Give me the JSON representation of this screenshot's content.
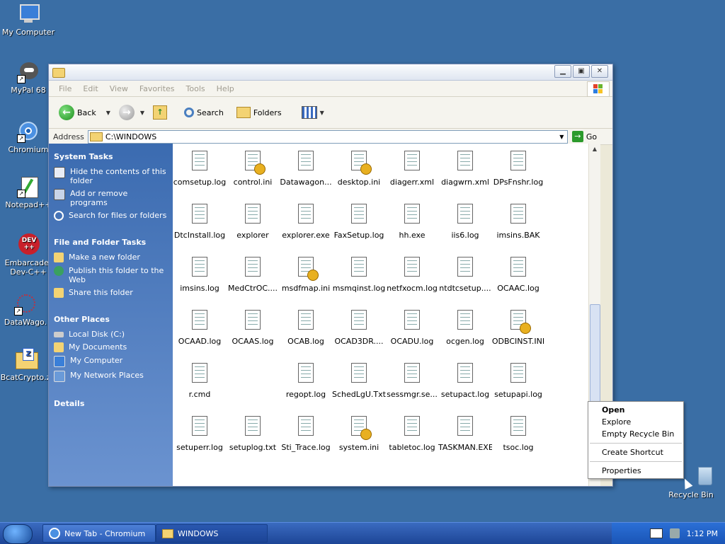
{
  "desktop": {
    "icons": [
      {
        "label": "My Computer",
        "icon": "computer-icon"
      },
      {
        "label": "MyPal 68",
        "icon": "raccoon-icon"
      },
      {
        "label": "Chromium",
        "icon": "chromium-icon"
      },
      {
        "label": "Notepad++",
        "icon": "notepad-icon"
      },
      {
        "label": "Embarcadero Dev-C++",
        "label_line1": "Embarcader",
        "label_line2": "Dev-C++",
        "icon": "devcpp-icon"
      },
      {
        "label": "DataWago.",
        "icon": "datawagon-icon"
      },
      {
        "label": "BcatCrypto.z",
        "icon": "zip-icon"
      },
      {
        "label": "Recycle Bin",
        "icon": "recycle-bin-icon"
      }
    ]
  },
  "window": {
    "menu": [
      "File",
      "Edit",
      "View",
      "Favorites",
      "Tools",
      "Help"
    ],
    "toolbar": {
      "back": "Back",
      "search": "Search",
      "folders": "Folders"
    },
    "address": {
      "label": "Address",
      "value": "C:\\WINDOWS",
      "go": "Go"
    },
    "taskpane": {
      "system_tasks": {
        "title": "System Tasks",
        "items": [
          "Hide the contents of this folder",
          "Add or remove programs",
          "Search for files or folders"
        ]
      },
      "file_folder_tasks": {
        "title": "File and Folder Tasks",
        "items": [
          "Make a new folder",
          "Publish this folder to the Web",
          "Share this folder"
        ]
      },
      "other_places": {
        "title": "Other Places",
        "items": [
          "Local Disk (C:)",
          "My Documents",
          "My Computer",
          "My Network Places"
        ]
      },
      "details": {
        "title": "Details"
      }
    },
    "files": [
      [
        "comsetup.log",
        "control.ini",
        "Datawagon...",
        "desktop.ini",
        "diagerr.xml",
        "diagwrn.xml",
        "DPsFnshr.log"
      ],
      [
        "DtcInstall.log",
        "explorer",
        "explorer.exe",
        "FaxSetup.log",
        "hh.exe",
        "iis6.log",
        "imsins.BAK"
      ],
      [
        "imsins.log",
        "MedCtrOC....",
        "msdfmap.ini",
        "msmqinst.log",
        "netfxocm.log",
        "ntdtcsetup....",
        "OCAAC.log"
      ],
      [
        "OCAAD.log",
        "OCAAS.log",
        "OCAB.log",
        "OCAD3DR....",
        "OCADU.log",
        "ocgen.log",
        "ODBCINST.INI"
      ],
      [
        "r.cmd",
        "",
        "regopt.log",
        "SchedLgU.Txt",
        "sessmgr.se...",
        "setupact.log",
        "setupapi.log"
      ],
      [
        "setuperr.log",
        "setuplog.txt",
        "Sti_Trace.log",
        "system.ini",
        "tabletoc.log",
        "TASKMAN.EXE",
        "tsoc.log"
      ]
    ]
  },
  "context_menu": {
    "items": [
      "Open",
      "Explore",
      "Empty Recycle Bin",
      "Create Shortcut",
      "Properties"
    ]
  },
  "taskbar": {
    "tasks": [
      "New Tab - Chromium",
      "WINDOWS"
    ],
    "clock": "1:12 PM"
  }
}
